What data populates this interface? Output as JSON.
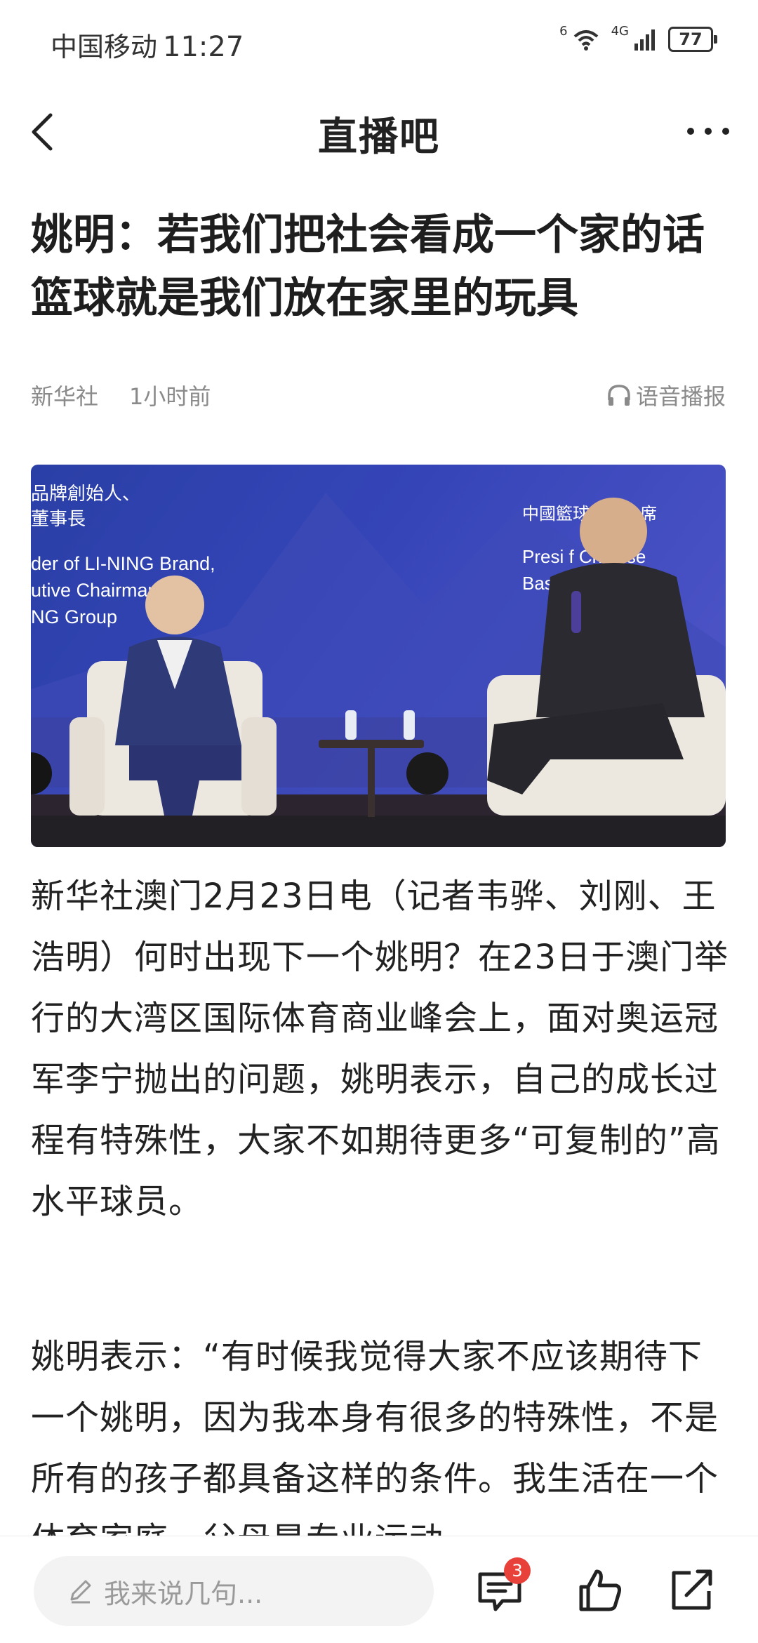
{
  "status_bar": {
    "carrier": "中国移动",
    "time": "11:27",
    "wifi_label": "6",
    "network_label": "4G",
    "battery": "77"
  },
  "nav": {
    "title": "直播吧"
  },
  "article": {
    "title": "姚明：若我们把社会看成一个家的话 篮球就是我们放在家里的玩具",
    "source": "新华社",
    "time": "1小时前",
    "audio_label": "语音播报",
    "photo": {
      "left_caption_cn_1": "品牌創始人、",
      "left_caption_cn_2": "董事長",
      "left_caption_en_1": "der of LI-NING Brand,",
      "left_caption_en_2": "utive Chairman of",
      "left_caption_en_3": "NG Group",
      "right_caption_cn": "中國籃球協會主席",
      "right_caption_en_1": "Presi      f Chinese",
      "right_caption_en_2": "Bask       ociation"
    },
    "paragraphs": [
      "新华社澳门2月23日电（记者韦骅、刘刚、王浩明）何时出现下一个姚明？在23日于澳门举行的大湾区国际体育商业峰会上，面对奥运冠军李宁抛出的问题，姚明表示，自己的成长过程有特殊性，大家不如期待更多“可复制的”高水平球员。",
      "姚明表示：“有时候我觉得大家不应该期待下一个姚明，因为我本身有很多的特殊性，不是所有的孩子都具备这样的条件。我生活在一个体育家庭，父母是专业运动"
    ]
  },
  "bottom_bar": {
    "comment_placeholder": "我来说几句...",
    "comment_count": "3"
  }
}
